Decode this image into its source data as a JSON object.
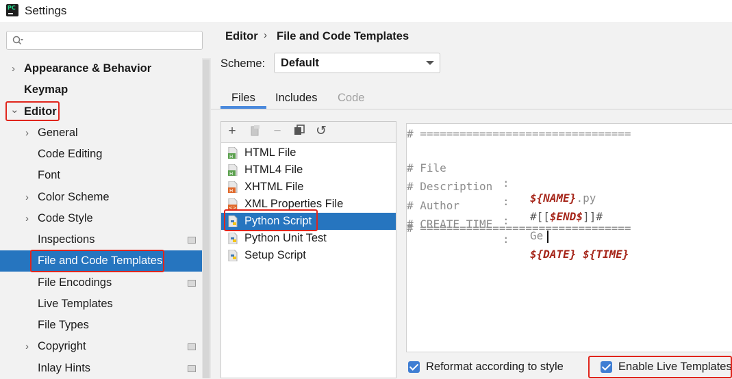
{
  "window": {
    "title": "Settings",
    "app_icon": "pycharm-icon"
  },
  "search": {
    "placeholder": ""
  },
  "sidebar": {
    "items": [
      {
        "label": "Appearance & Behavior",
        "expander": "›"
      },
      {
        "label": "Keymap"
      },
      {
        "label": "Editor",
        "expander": "⌄"
      },
      {
        "label": "General",
        "expander": "›"
      },
      {
        "label": "Code Editing"
      },
      {
        "label": "Font"
      },
      {
        "label": "Color Scheme",
        "expander": "›"
      },
      {
        "label": "Code Style",
        "expander": "›"
      },
      {
        "label": "Inspections"
      },
      {
        "label": "File and Code Templates",
        "selected": true
      },
      {
        "label": "File Encodings"
      },
      {
        "label": "Live Templates"
      },
      {
        "label": "File Types"
      },
      {
        "label": "Copyright",
        "expander": "›"
      },
      {
        "label": "Inlay Hints"
      }
    ]
  },
  "breadcrumb": {
    "parent": "Editor",
    "separator": "›",
    "current": "File and Code Templates"
  },
  "scheme": {
    "label": "Scheme:",
    "value": "Default"
  },
  "tabs": [
    {
      "label": "Files",
      "active": true
    },
    {
      "label": "Includes"
    },
    {
      "label": "Code",
      "disabled": true
    }
  ],
  "toolbar": {
    "add": "+",
    "remove": "−",
    "reset": "↺"
  },
  "templates": [
    {
      "label": "HTML File",
      "icon": "html-file-icon"
    },
    {
      "label": "HTML4 File",
      "icon": "html-file-icon"
    },
    {
      "label": "XHTML File",
      "icon": "xhtml-file-icon"
    },
    {
      "label": "XML Properties File",
      "icon": "xml-file-icon"
    },
    {
      "label": "Python Script",
      "icon": "python-file-icon",
      "selected": true
    },
    {
      "label": "Python Unit Test",
      "icon": "python-file-icon"
    },
    {
      "label": "Setup Script",
      "icon": "python-file-icon"
    }
  ],
  "editor": {
    "divider": "# ================================",
    "lines": [
      {
        "key": "# File",
        "sep": ":",
        "var": "${NAME}",
        "suffix": ".py"
      },
      {
        "key": "# Description",
        "sep": ":",
        "prefix": "#[[",
        "var": "$END$",
        "suffix": "]]#"
      },
      {
        "key": "# Author",
        "sep": ":",
        "value": "Ge"
      },
      {
        "key": "# CREATE TIME",
        "sep": ":",
        "var": "${DATE}",
        "var2": "${TIME}"
      }
    ]
  },
  "options": {
    "reformat": "Reformat according to style",
    "live_templates": "Enable Live Templates"
  },
  "colors": {
    "accent": "#2675bf",
    "highlight": "#e0251c",
    "template_var": "#a6261a"
  }
}
